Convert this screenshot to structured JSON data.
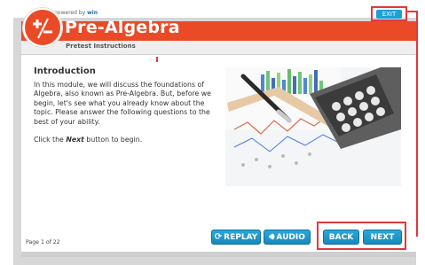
{
  "header": {
    "powered_prefix": "powered by",
    "powered_brand": "win",
    "app_title": "Pre-Algebra",
    "subtitle": "Pretest Instructions",
    "exit_label": "EXIT"
  },
  "content": {
    "heading": "Introduction",
    "paragraph": "In this module, we will discuss the foundations of Algebra, also known as Pre-Algebra. But, before we begin, let's see what you already know about the topic. Please answer the following questions to the best of your ability.",
    "instruction_prefix": "Click the ",
    "instruction_emphasis": "Next",
    "instruction_suffix": " button to begin."
  },
  "footer": {
    "page_counter": "Page 1 of 22",
    "replay_label": "REPLAY",
    "audio_label": "AUDIO",
    "back_label": "BACK",
    "next_label": "NEXT"
  },
  "colors": {
    "brand": "#ea4b26",
    "button": "#1ca0d8",
    "highlight": "#e0383e"
  }
}
